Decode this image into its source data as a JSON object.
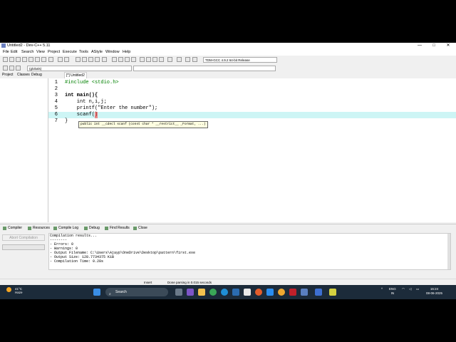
{
  "window": {
    "title": "Untitled2 - Dev-C++ 5.11"
  },
  "menu": [
    "File",
    "Edit",
    "Search",
    "View",
    "Project",
    "Execute",
    "Tools",
    "AStyle",
    "Window",
    "Help"
  ],
  "toolbar": {
    "compiler_select": "TDM-GCC 4.9.2 64-bit Release",
    "globals_select": "(globals)"
  },
  "left_panel": {
    "tabs": [
      "Project",
      "Classes",
      "Debug"
    ]
  },
  "editor": {
    "tab": "[*] Untitled2",
    "lines": [
      {
        "n": "1",
        "text": "#include <stdio.h>"
      },
      {
        "n": "2",
        "text": ""
      },
      {
        "n": "3",
        "text": "int main(){"
      },
      {
        "n": "4",
        "text": "    int n,i,j;"
      },
      {
        "n": "5",
        "text": "    printf(\"Enter the number\");"
      },
      {
        "n": "6",
        "text": "    scanf()"
      },
      {
        "n": "7",
        "text": "}"
      }
    ],
    "tooltip": "public int __cdecl scanf (const char * __restrict__ _Format, ...)"
  },
  "bottom_tabs": [
    "Compiler",
    "Resources",
    "Compile Log",
    "Debug",
    "Find Results",
    "Close"
  ],
  "compile": {
    "abort_label": "Abort Compilation",
    "log": [
      "Compilation results...",
      "--------",
      "- Errors: 0",
      "- Warnings: 0",
      "- Output Filename: C:\\Users\\Ajayp\\OneDrive\\Desktop\\pattern\\first.exe",
      "- Output Size: 128.7734375 KiB",
      "- Compilation Time: 0.28s"
    ]
  },
  "status": {
    "mode": "Insert",
    "message": "Done parsing in 0.015 seconds"
  },
  "taskbar": {
    "weather_temp": "41°C",
    "weather_desc": "Haze",
    "search_label": "Search",
    "lang_1": "ENG",
    "lang_2": "IN",
    "time": "16:24",
    "date": "08-06-2025"
  }
}
